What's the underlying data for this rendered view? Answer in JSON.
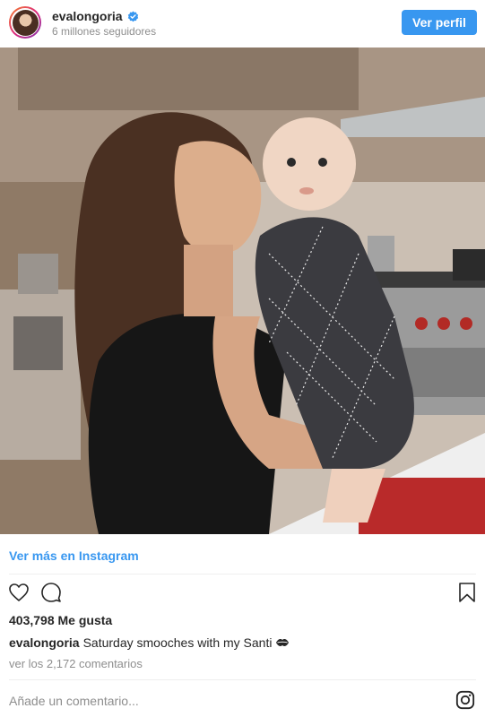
{
  "header": {
    "username": "evalongoria",
    "followers": "6 millones seguidores",
    "view_profile_label": "Ver perfil"
  },
  "post": {
    "view_more_label": "Ver más en Instagram",
    "likes": "403,798 Me gusta",
    "caption_user": "evalongoria",
    "caption_text": "Saturday smooches with my Santi",
    "comments_link": "ver los 2,172 comentarios",
    "add_comment_placeholder": "Añade un comentario..."
  },
  "icons": {
    "like": "heart-icon",
    "comment": "comment-icon",
    "save": "bookmark-icon",
    "verified": "verified-badge-icon",
    "kiss": "kiss-emoji-icon",
    "instagram": "instagram-logo-icon"
  },
  "colors": {
    "accent": "#3897f0",
    "text": "#262626",
    "muted": "#8e8e8e"
  }
}
